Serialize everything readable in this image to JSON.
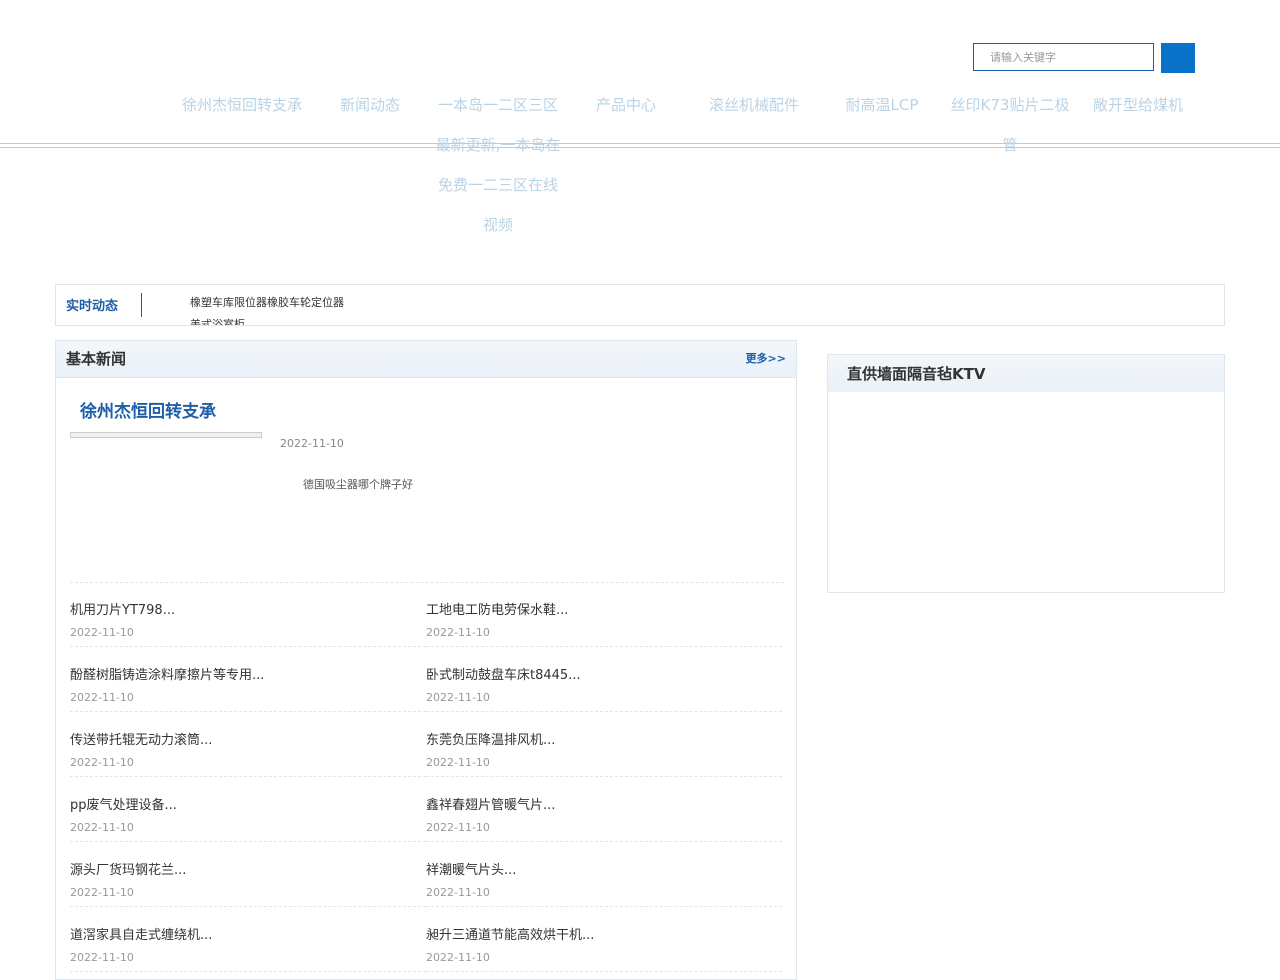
{
  "search": {
    "placeholder": "请输入关键字"
  },
  "nav": [
    "徐州杰恒回转支承",
    "新闻动态",
    "一本岛一二区三区最新更新,一本岛在免费一二三区在线视频",
    "产品中心",
    "滚丝机械配件",
    "耐高温LCP",
    "丝印K73贴片二极管",
    "敞开型给煤机"
  ],
  "ticker": {
    "title": "实时动态",
    "items": [
      "橡塑车库限位器橡胶车轮定位器",
      "美式浴室柜"
    ]
  },
  "news": {
    "title": "基本新闻",
    "more": "更多>>",
    "feature": {
      "title": "徐州杰恒回转支承",
      "date": "2022-11-10",
      "summary": "德国吸尘器哪个牌子好"
    },
    "items": [
      {
        "title": "机用刀片YT798...",
        "date": "2022-11-10"
      },
      {
        "title": "工地电工防电劳保水鞋...",
        "date": "2022-11-10"
      },
      {
        "title": "酚醛树脂铸造涂料摩擦片等专用...",
        "date": "2022-11-10"
      },
      {
        "title": "卧式制动鼓盘车床t8445...",
        "date": "2022-11-10"
      },
      {
        "title": "传送带托辊无动力滚筒...",
        "date": "2022-11-10"
      },
      {
        "title": "东莞负压降温排风机...",
        "date": "2022-11-10"
      },
      {
        "title": "pp废气处理设备...",
        "date": "2022-11-10"
      },
      {
        "title": "鑫祥春翅片管暖气片...",
        "date": "2022-11-10"
      },
      {
        "title": "源头厂货玛钢花兰...",
        "date": "2022-11-10"
      },
      {
        "title": "祥潮暖气片头...",
        "date": "2022-11-10"
      },
      {
        "title": "道滘家具自走式缠绕机...",
        "date": "2022-11-10"
      },
      {
        "title": "昶升三通道节能高效烘干机...",
        "date": "2022-11-10"
      }
    ]
  },
  "side": {
    "title": "直供墙面隔音毡KTV"
  }
}
